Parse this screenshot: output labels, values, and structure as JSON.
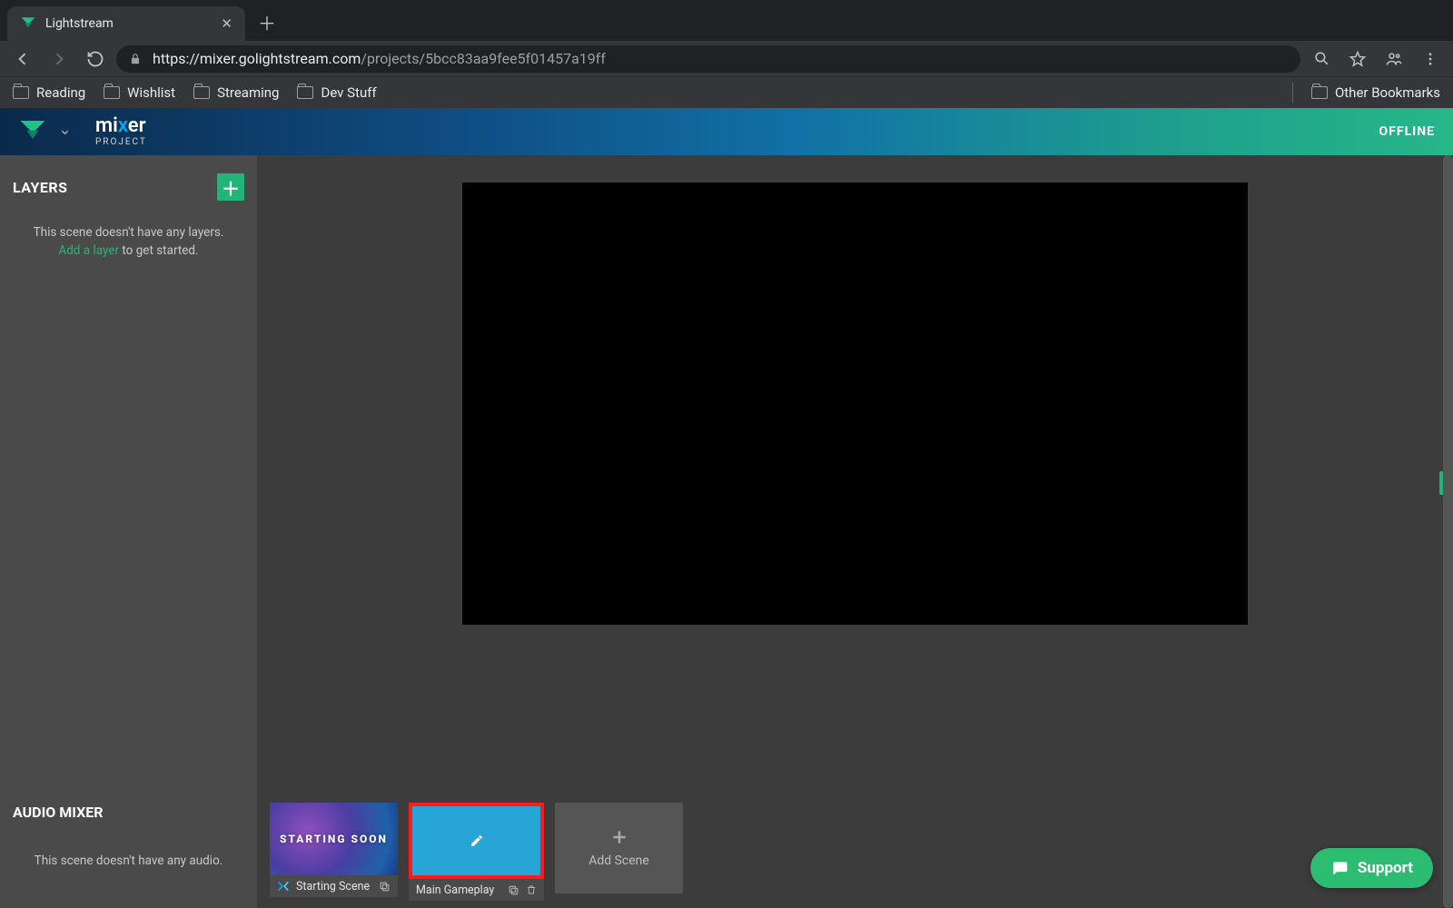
{
  "browser": {
    "tab_title": "Lightstream",
    "url_display_prefix": "https://mixer.golightstream.com",
    "url_display_suffix": "/projects/5bcc83aa9fee5f01457a19ff",
    "bookmarks": [
      "Reading",
      "Wishlist",
      "Streaming",
      "Dev Stuff"
    ],
    "other_bookmarks_label": "Other Bookmarks"
  },
  "header": {
    "mixer_pre": "mi",
    "mixer_x": "x",
    "mixer_post": "er",
    "mixer_sub": "PROJECT",
    "status": "OFFLINE"
  },
  "sidebar": {
    "layers_title": "LAYERS",
    "empty_line1": "This scene doesn't have any layers.",
    "empty_link": "Add a layer",
    "empty_line2": " to get started.",
    "audio_title": "AUDIO MIXER",
    "audio_empty": "This scene doesn't have any audio."
  },
  "scenes": {
    "starting_overlay": "STARTING SOON",
    "starting_name": "Starting Scene",
    "main_name": "Main Gameplay",
    "add_label": "Add Scene"
  },
  "support_label": "Support"
}
